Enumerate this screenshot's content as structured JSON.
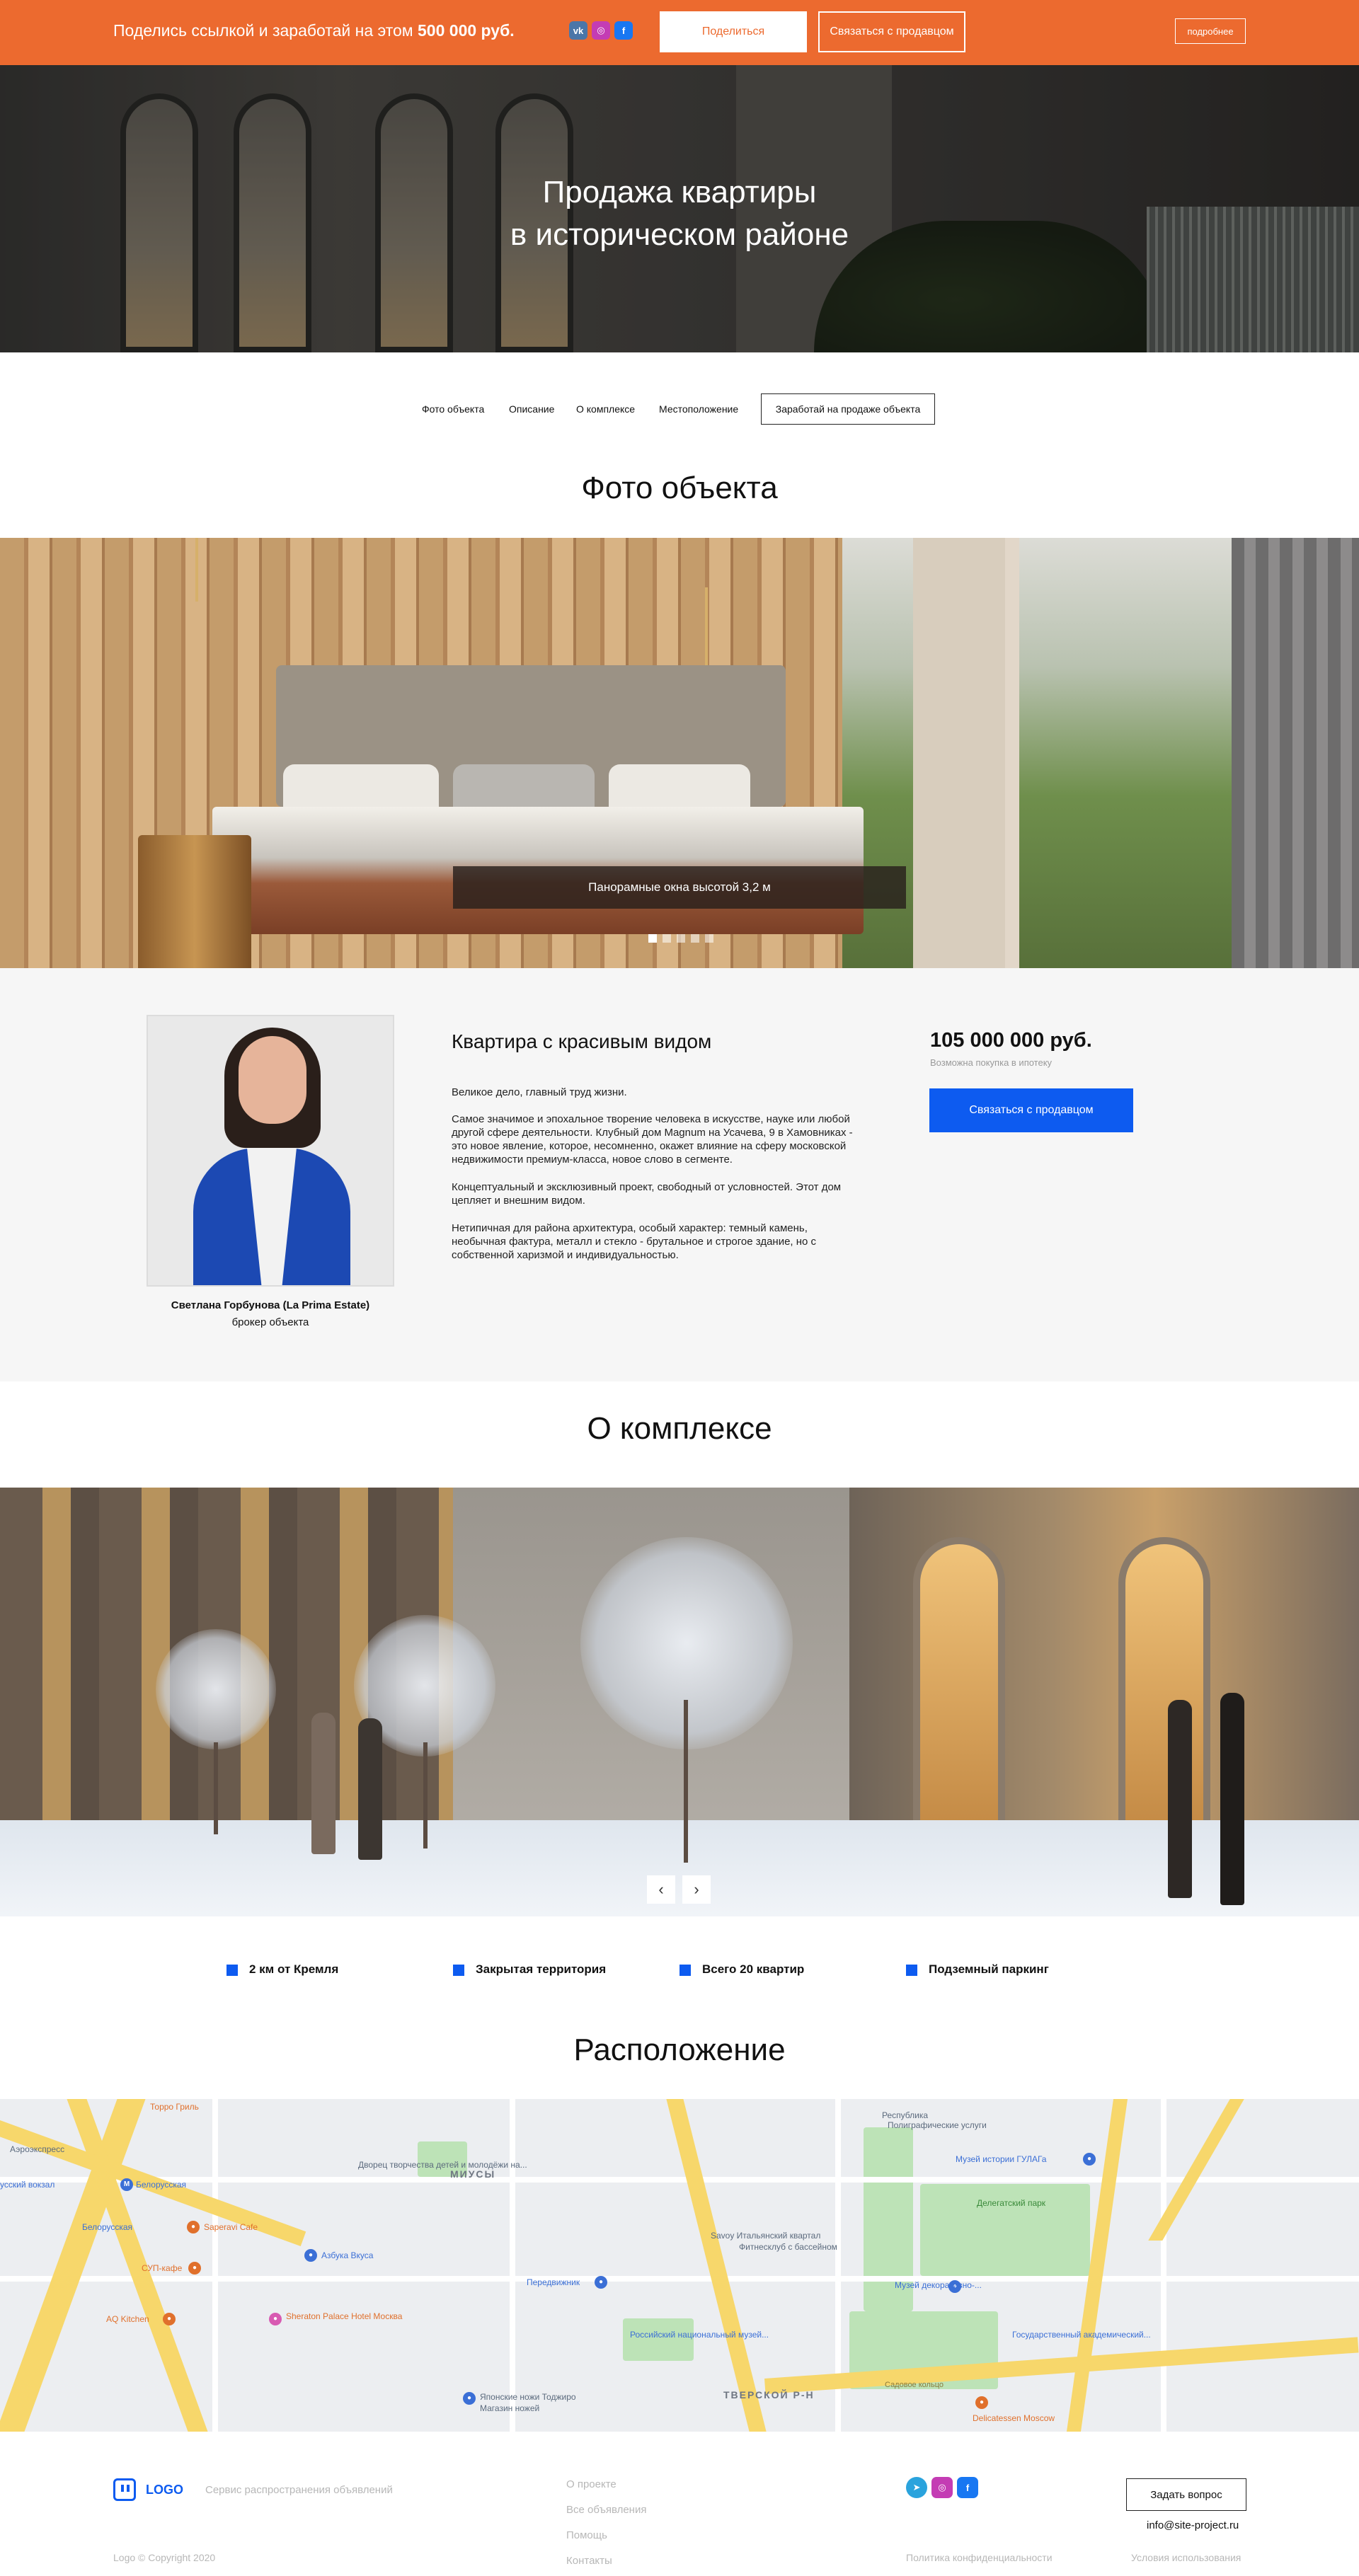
{
  "topbar": {
    "promo_text": "Поделись ссылкой и заработай на этом ",
    "promo_amount": "500 000 руб.",
    "share_button": "Поделиться",
    "contact_button": "Связаться с продавцом",
    "more_button": "подробнее",
    "social": [
      "vk-icon",
      "instagram-icon",
      "facebook-icon"
    ]
  },
  "hero": {
    "title_line1": "Продажа квартиры",
    "title_line2": "в историческом районе"
  },
  "anchor_nav": {
    "items": [
      "Фото объекта",
      "Описание",
      "О комплексе",
      "Местоположение"
    ],
    "earn_button": "Заработай на продаже объекта"
  },
  "photos": {
    "heading": "Фото объекта",
    "caption": "Панорамные окна высотой 3,2 м",
    "slide_count": 5,
    "active_slide": 1
  },
  "listing": {
    "agent_name": "Светлана Горбунова (La Prima Estate)",
    "agent_role": "брокер объекта",
    "title": "Квартира с красивым видом",
    "paragraphs": [
      "Великое дело, главный труд жизни.",
      "Самое значимое и эпохальное творение человека в искусстве, науке или любой другой сфере деятельности. Клубный дом Magnum на Усачева, 9 в Хамовниках - это новое явление, которое, несомненно, окажет влияние на сферу московской недвижимости премиум-класса, новое слово в сегменте.",
      "Концептуальный и эксклюзивный проект, свободный от условностей. Этот дом цепляет и внешним видом.",
      "Нетипичная для района архитектура, особый характер: темный камень, необычная фактура, металл и стекло - брутальное и строгое здание, но с собственной харизмой и индивидуальностью."
    ],
    "price": "105 000 000 руб.",
    "mortgage_note": "Возможна покупка в ипотеку",
    "contact_button": "Связаться с продавцом"
  },
  "complex": {
    "heading": "О комплексе",
    "prev_arrow": "‹",
    "next_arrow": "›",
    "features": [
      "2 км от Кремля",
      "Закрытая территория",
      "Всего 20 квартир",
      "Подземный паркинг"
    ]
  },
  "location": {
    "heading": "Расположение",
    "map_labels": [
      "Торро Гриль",
      "Аэроэкспресс",
      "Дворец творчества детей и молодёжи на...",
      "Белорусская",
      "усский вокзал",
      "Белорусская",
      "Saperavi Cafe",
      "Азбука Вкуса",
      "СУП-кафе",
      "МИУСЫ",
      "AQ Kitchen",
      "Sheraton Palace Hotel Москва",
      "Японские ножи Тоджиро",
      "Магазин ножей",
      "Передвижник",
      "Российский национальный музей...",
      "Savoy Итальянский квартал",
      "Фитнесклуб с бассейном",
      "Музей декоративно-...",
      "Республика",
      "Полиграфические услуги",
      "Музей истории ГУЛАГа",
      "Делегатский парк",
      "Государственный академический...",
      "ТВЕРСКОЙ Р-Н",
      "Садовое кольцо",
      "Delicatessen Moscow"
    ]
  },
  "footer": {
    "logo_text": "LOGO",
    "service_text": "Сервис распространения объявлений",
    "links": [
      "О проекте",
      "Все объявления",
      "Помощь",
      "Контакты"
    ],
    "copyright": "Logo © Copyright 2020",
    "policy": "Политика конфиденциальности",
    "ask_button": "Задать вопрос",
    "email": "info@site-project.ru",
    "terms": "Условия использования",
    "social": [
      "telegram-icon",
      "instagram-icon",
      "facebook-icon"
    ]
  },
  "colors": {
    "brand_orange": "#ec6a2f",
    "accent_blue": "#0d5bf0"
  }
}
